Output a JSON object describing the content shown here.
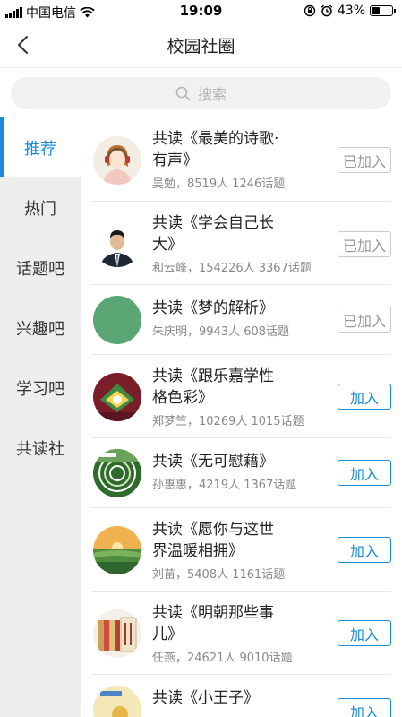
{
  "status_bar": {
    "carrier": "中国电信",
    "time": "19:09",
    "battery": "43%",
    "battery_level": 0.43
  },
  "nav": {
    "title": "校园社圈"
  },
  "search": {
    "placeholder": "搜索"
  },
  "sidebar": {
    "items": [
      {
        "label": "推荐",
        "active": true
      },
      {
        "label": "热门"
      },
      {
        "label": "话题吧"
      },
      {
        "label": "兴趣吧"
      },
      {
        "label": "学习吧"
      },
      {
        "label": "共读社"
      }
    ]
  },
  "groups": [
    {
      "title_line1": "共读《最美的诗歌·",
      "title_line2": "有声》",
      "meta": "吴勉，8519人 1246话题",
      "button": "已加入",
      "joined": true,
      "avatar": "girl-headphones"
    },
    {
      "title_line1": "共读《学会自己长",
      "title_line2": "大》",
      "meta": "和云峰，154226人 3367话题",
      "button": "已加入",
      "joined": true,
      "avatar": "man-portrait"
    },
    {
      "title_line1": "共读《梦的解析》",
      "title_line2": "",
      "meta": "朱庆明，9943人 608话题",
      "button": "已加入",
      "joined": true,
      "avatar": "green-circle"
    },
    {
      "title_line1": "共读《跟乐嘉学性",
      "title_line2": "格色彩》",
      "meta": "郑梦竺，10269人 1015话题",
      "button": "加入",
      "joined": false,
      "avatar": "book-cover-red"
    },
    {
      "title_line1": "共读《无可慰藉》",
      "title_line2": "",
      "meta": "孙惠惠，4219人 1367话题",
      "button": "加入",
      "joined": false,
      "avatar": "book-cover-green"
    },
    {
      "title_line1": "共读《愿你与这世",
      "title_line2": "界温暖相拥》",
      "meta": "刘苗，5408人 1161话题",
      "button": "加入",
      "joined": false,
      "avatar": "sunset-landscape"
    },
    {
      "title_line1": "共读《明朝那些事",
      "title_line2": "儿》",
      "meta": "任燕，24621人 9010话题",
      "button": "加入",
      "joined": false,
      "avatar": "books-stack"
    },
    {
      "title_line1": "共读《小王子》",
      "title_line2": "",
      "meta": "",
      "button": "加入",
      "joined": false,
      "avatar": "little-prince-cover"
    }
  ],
  "colors": {
    "accent": "#1a8cd8",
    "sidebar_bg": "#eeeeee",
    "joined_gray": "#999999"
  }
}
